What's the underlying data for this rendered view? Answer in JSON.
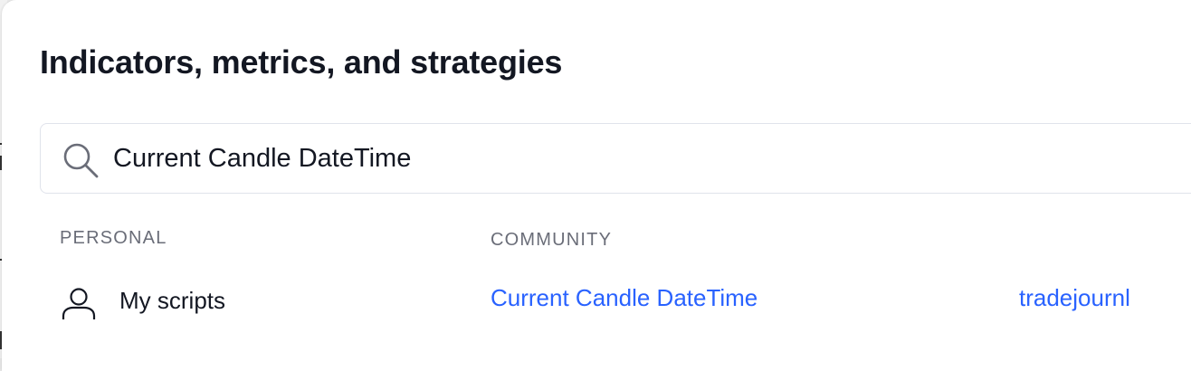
{
  "dialog": {
    "title": "Indicators, metrics, and strategies"
  },
  "search": {
    "value": "Current Candle DateTime",
    "icon": "search-icon"
  },
  "sections": {
    "personal": {
      "label": "PERSONAL",
      "items": [
        {
          "label": "My scripts",
          "icon": "user-icon"
        }
      ]
    },
    "community": {
      "label": "COMMUNITY",
      "results": [
        {
          "name": "Current Candle DateTime",
          "author": "tradejournl"
        }
      ]
    }
  },
  "colors": {
    "accent": "#2962ff",
    "text": "#131722",
    "muted": "#6a6d78",
    "border": "#e0e3eb"
  }
}
